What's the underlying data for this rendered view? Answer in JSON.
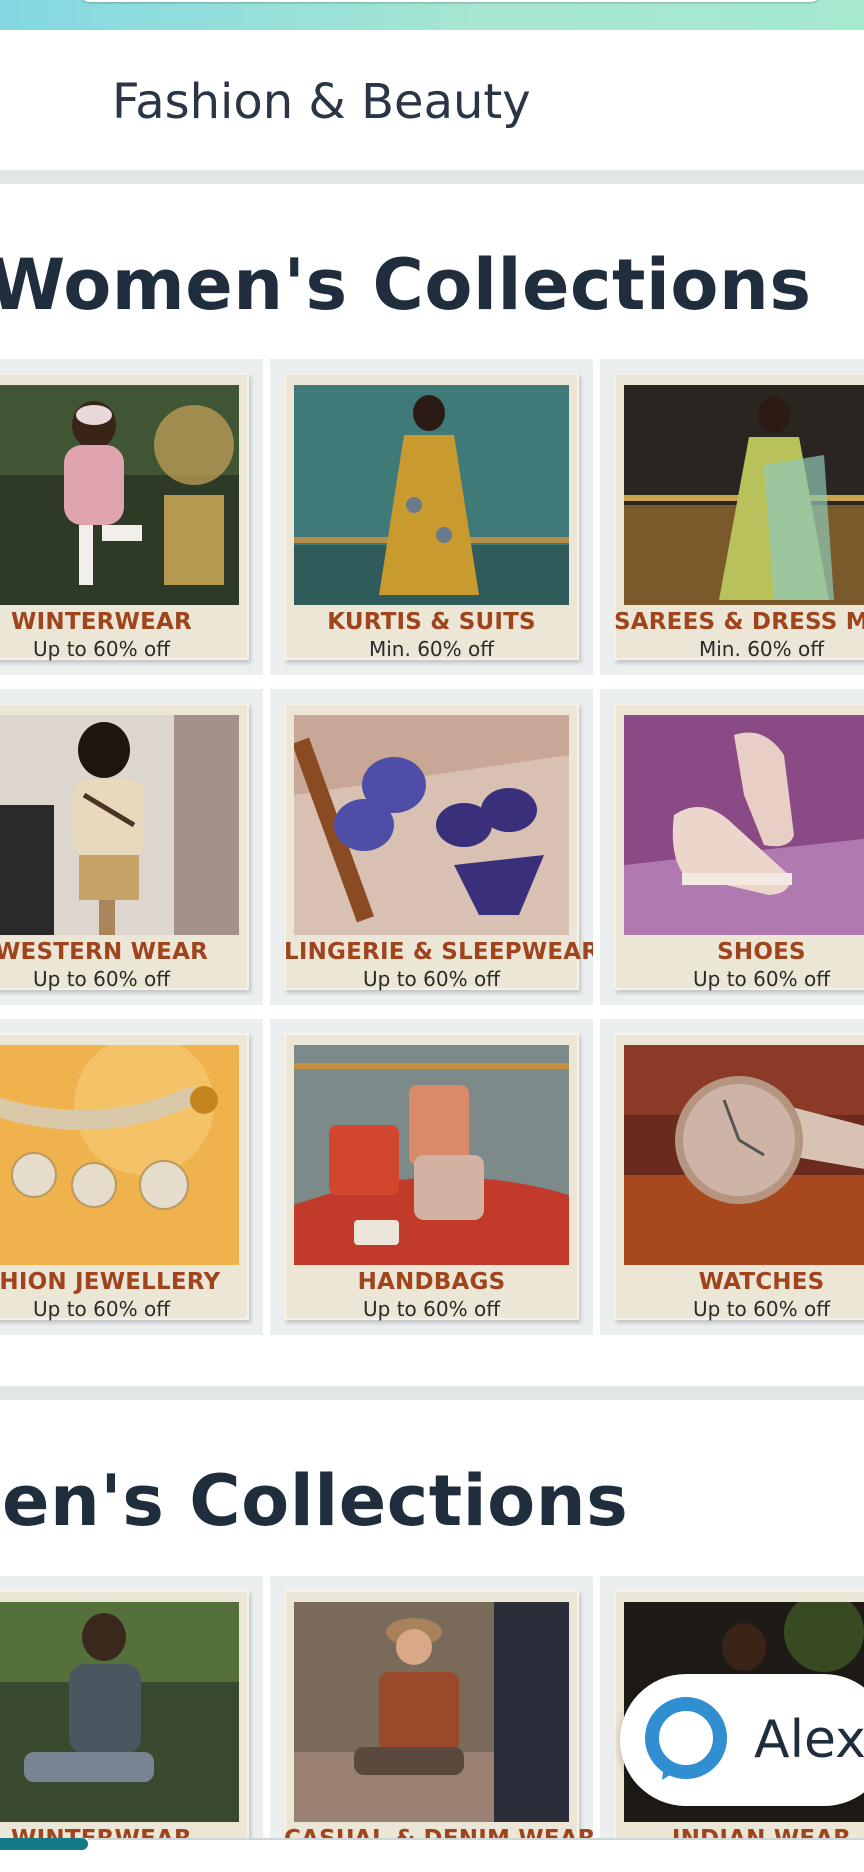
{
  "header": {
    "subtitle": "Fashion & Beauty"
  },
  "sections": [
    {
      "title": "Women's Collections",
      "cards": [
        {
          "title": "WINTERWEAR",
          "offer": "Up to 60% off"
        },
        {
          "title": "KURTIS & SUITS",
          "offer": "Min. 60% off"
        },
        {
          "title": "SAREES & DRESS MATERIA",
          "offer": "Min. 60% off"
        },
        {
          "title": "WESTERN WEAR",
          "offer": "Up to 60% off"
        },
        {
          "title": "LINGERIE & SLEEPWEAR",
          "offer": "Up to 60% off"
        },
        {
          "title": "SHOES",
          "offer": "Up to 60% off"
        },
        {
          "title": "SHION JEWELLERY",
          "offer": "Up to 60% off"
        },
        {
          "title": "HANDBAGS",
          "offer": "Up to 60% off"
        },
        {
          "title": "WATCHES",
          "offer": "Up to 60% off"
        }
      ]
    },
    {
      "title": "en's Collections",
      "cards": [
        {
          "title": "WINTERWEAR",
          "offer": ""
        },
        {
          "title": "CASUAL & DENIM WEAR",
          "offer": ""
        },
        {
          "title": "INDIAN WEAR",
          "offer": ""
        }
      ]
    }
  ],
  "alexa": {
    "label": "Alexa"
  },
  "colors": {
    "accent": "#137a86",
    "card_title": "#a0441e",
    "heading": "#1f2d3d",
    "alexa_ring": "#2f8fd0"
  }
}
